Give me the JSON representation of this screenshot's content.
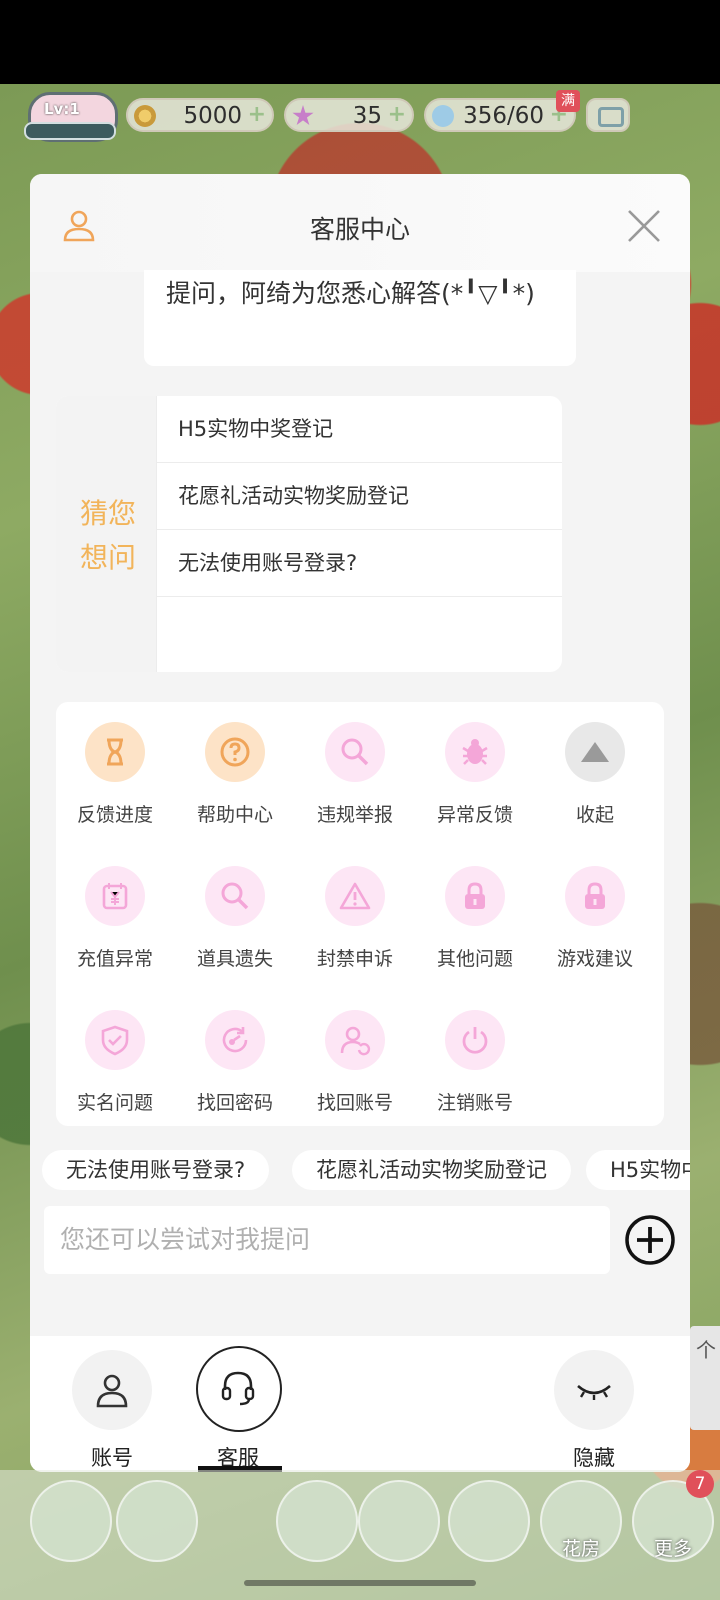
{
  "hud": {
    "level": "Lv:1",
    "coins": "5000",
    "stars": "35",
    "water": "356/60",
    "full_badge": "满"
  },
  "dialog": {
    "title": "客服中心",
    "chat_text": "提问，阿绮为您悉心解答(*╹▽╹*)",
    "guess": {
      "label": "猜您想问",
      "items": [
        "H5实物中奖登记",
        "花愿礼活动实物奖励登记",
        "无法使用账号登录?"
      ]
    },
    "grid": [
      {
        "label": "反馈进度",
        "icon": "hourglass-icon"
      },
      {
        "label": "帮助中心",
        "icon": "help-icon"
      },
      {
        "label": "违规举报",
        "icon": "search-icon"
      },
      {
        "label": "异常反馈",
        "icon": "bug-icon"
      },
      {
        "label": "收起",
        "icon": "triangle-up-icon"
      },
      {
        "label": "充值异常",
        "icon": "calendar-yen-icon"
      },
      {
        "label": "道具遗失",
        "icon": "search-icon"
      },
      {
        "label": "封禁申诉",
        "icon": "warning-icon"
      },
      {
        "label": "其他问题",
        "icon": "lock-icon"
      },
      {
        "label": "游戏建议",
        "icon": "lock-icon"
      },
      {
        "label": "实名问题",
        "icon": "shield-icon"
      },
      {
        "label": "找回密码",
        "icon": "key-refresh-icon"
      },
      {
        "label": "找回账号",
        "icon": "user-refresh-icon"
      },
      {
        "label": "注销账号",
        "icon": "power-icon"
      }
    ],
    "chips": [
      "无法使用账号登录?",
      "花愿礼活动实物奖励登记",
      "H5实物中奖登记"
    ],
    "input_placeholder": "您还可以尝试对我提问",
    "tabs": [
      {
        "label": "账号",
        "icon": "user-icon"
      },
      {
        "label": "客服",
        "icon": "headset-icon",
        "active": true
      },
      {
        "label": "隐藏",
        "icon": "eye-closed-icon"
      }
    ]
  },
  "side_arrow": "个",
  "game_nav": {
    "items": [
      {
        "label": "",
        "icon": "house-icon"
      },
      {
        "label": "",
        "icon": "bean-icon"
      },
      {
        "label": "",
        "icon": "gear-flower-icon"
      },
      {
        "label": "",
        "icon": "cube-icon"
      },
      {
        "label": "",
        "icon": "box-icon"
      },
      {
        "label": "花房",
        "icon": "flower-house-icon"
      },
      {
        "label": "更多",
        "icon": "chevrons-up-icon"
      }
    ],
    "badge": "7"
  },
  "colors": {
    "accent_orange": "#f2b45a",
    "icon_pink": "#f4a6d8",
    "icon_orange": "#f0a55a"
  }
}
